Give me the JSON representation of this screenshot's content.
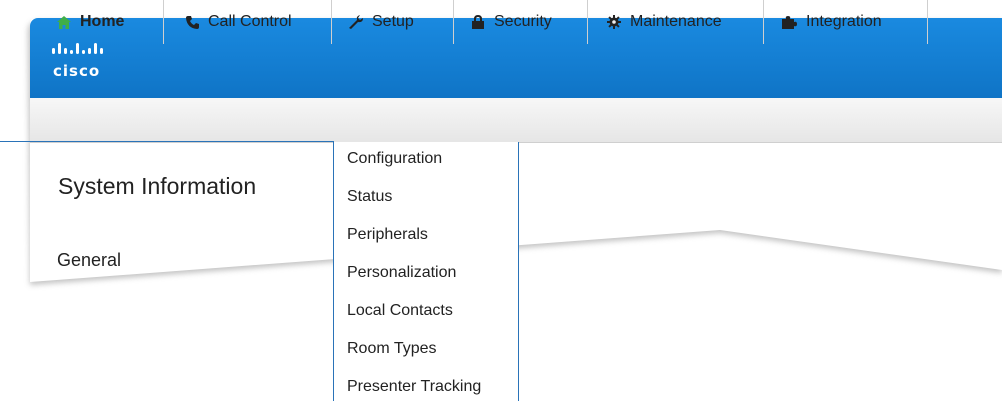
{
  "brand": {
    "logo_text": "cisco"
  },
  "nav": {
    "tabs": [
      {
        "label": "Home",
        "icon": "home-icon"
      },
      {
        "label": "Call Control",
        "icon": "phone-icon"
      },
      {
        "label": "Setup",
        "icon": "wrench-icon"
      },
      {
        "label": "Security",
        "icon": "lock-icon"
      },
      {
        "label": "Maintenance",
        "icon": "gear-icon"
      },
      {
        "label": "Integration",
        "icon": "puzzle-icon"
      }
    ],
    "active": "Home"
  },
  "main": {
    "title": "System Information",
    "section": "General"
  },
  "setup_menu": {
    "items": [
      "Configuration",
      "Status",
      "Peripherals",
      "Personalization",
      "Local Contacts",
      "Room Types",
      "Presenter Tracking"
    ]
  },
  "colors": {
    "header_blue": "#1280d6",
    "accent_green": "#3fae49",
    "highlight_frame": "#2a73b8"
  }
}
